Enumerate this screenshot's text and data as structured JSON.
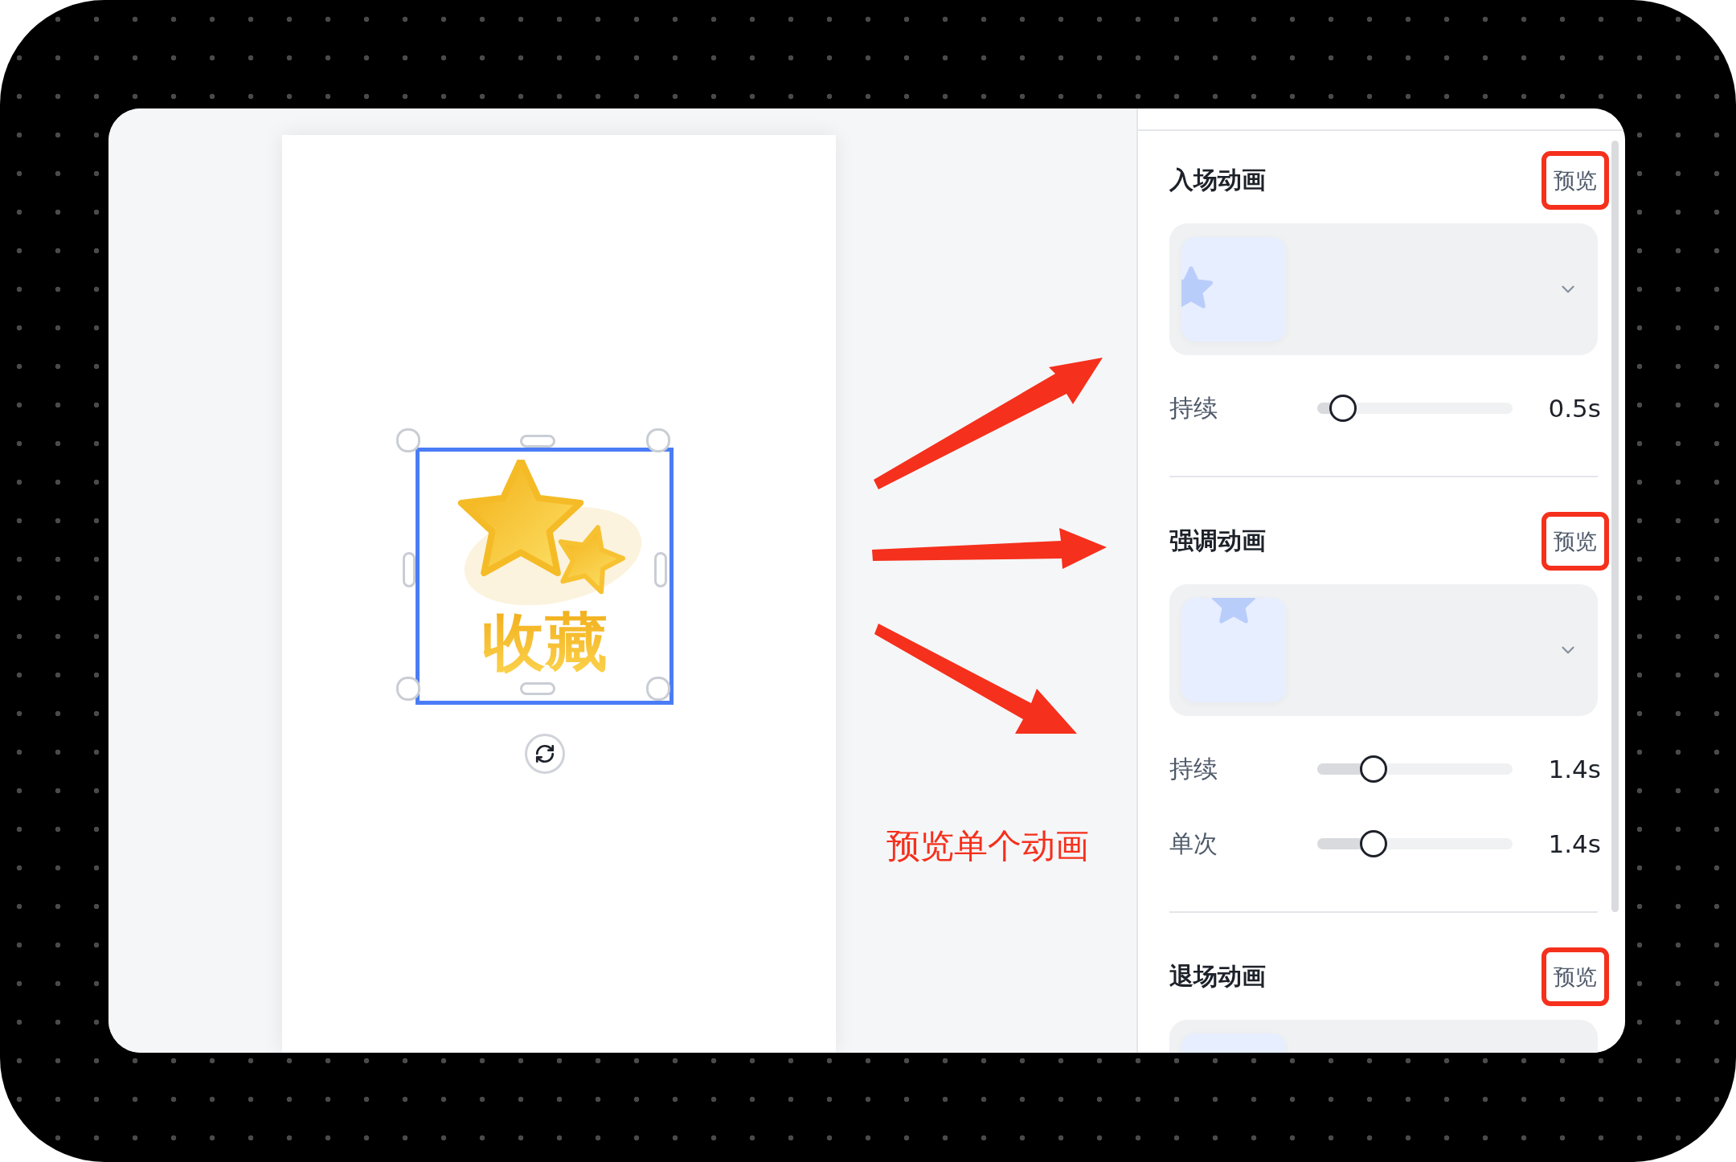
{
  "canvas": {
    "element": {
      "label": "收藏",
      "selected": true
    }
  },
  "annotation": {
    "caption": "预览单个动画"
  },
  "panel": {
    "sections": [
      {
        "kind": "enter",
        "title": "入场动画",
        "preview": "预览",
        "highlighted": true,
        "sliders": [
          {
            "label": "持续",
            "level": 0.13,
            "reading": "0.5s"
          }
        ]
      },
      {
        "kind": "emphasis",
        "title": "强调动画",
        "preview": "预览",
        "highlighted": true,
        "sliders": [
          {
            "label": "持续",
            "level": 0.29,
            "reading": "1.4s"
          },
          {
            "label": "单次",
            "level": 0.29,
            "reading": "1.4s"
          }
        ]
      },
      {
        "kind": "exit",
        "title": "退场动画",
        "preview": "预览",
        "highlighted": true
      }
    ]
  }
}
